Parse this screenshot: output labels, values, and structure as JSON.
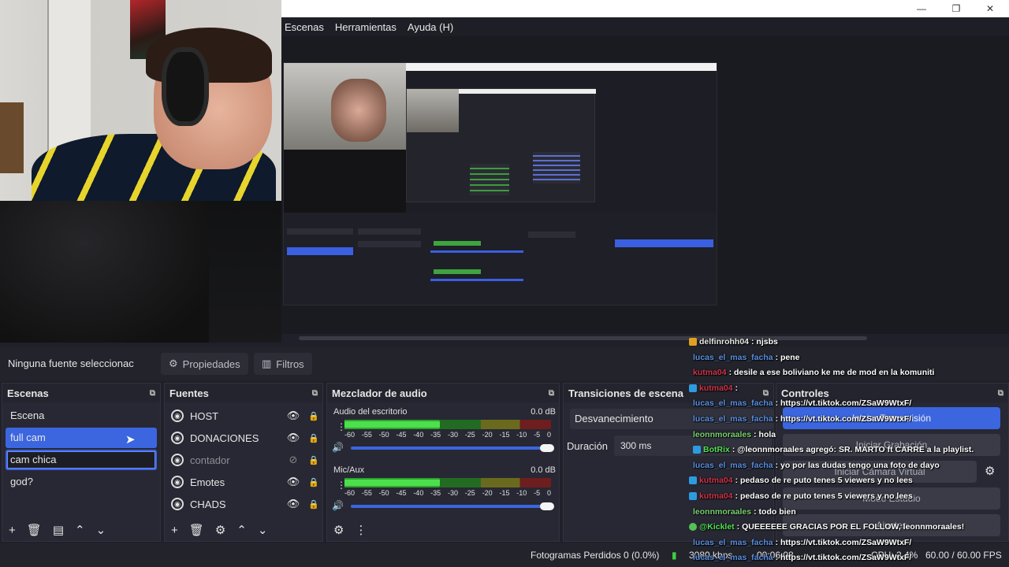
{
  "menubar": {
    "items": [
      "Escenas",
      "Herramientas",
      "Ayuda (H)"
    ]
  },
  "window": {
    "minimize": "—",
    "maximize": "❐",
    "close": "✕"
  },
  "context": {
    "no_source": "Ninguna fuente seleccionac",
    "properties": "Propiedades",
    "filters": "Filtros"
  },
  "scenes": {
    "title": "Escenas",
    "items": [
      "Escena",
      "full cam",
      "cam chica",
      "god?"
    ]
  },
  "sources": {
    "title": "Fuentes",
    "items": [
      "HOST",
      "DONACIONES",
      "contador",
      "Emotes",
      "CHADS"
    ]
  },
  "mixer": {
    "title": "Mezclador de audio",
    "channels": [
      {
        "name": "Audio del escritorio",
        "db": "0.0 dB",
        "level": 0.46
      },
      {
        "name": "Mic/Aux",
        "db": "0.0 dB",
        "level": 0.46
      }
    ],
    "ticks": [
      "-60",
      "-55",
      "-50",
      "-45",
      "-40",
      "-35",
      "-30",
      "-25",
      "-20",
      "-15",
      "-10",
      "-5",
      "0"
    ]
  },
  "transitions": {
    "title": "Transiciones de escena",
    "selected": "Desvanecimiento",
    "duration_label": "Duración",
    "duration_value": "300 ms"
  },
  "controls": {
    "title": "Controles",
    "buttons": [
      "Iniciar Transmisión",
      "Iniciar Grabación",
      "Iniciar Cámara Virtual",
      "Modo Estudio",
      "Ajustes"
    ]
  },
  "status": {
    "dropped": "Fotogramas Perdidos 0 (0.0%)",
    "kbps": "3080 kbps",
    "time": "00:06:08",
    "cpu": "CPU: 2.4%",
    "fps": "60.00 / 60.00 FPS"
  },
  "chat": [
    {
      "user": "delfinrohh04",
      "msg": ": njsbs",
      "color": "#e8e8e8",
      "icon": "#e0a020"
    },
    {
      "user": "lucas_el_mas_facha",
      "msg": ": pene",
      "color": "#5b8fe0",
      "icon": ""
    },
    {
      "user": "kutma04",
      "msg": ": desile a ese boliviano ke me de mod en la komuniti",
      "color": "#d0344a",
      "icon": ""
    },
    {
      "user": "kutma04",
      "msg": ":",
      "color": "#d0344a",
      "icon": "#2d9be0"
    },
    {
      "user": "lucas_el_mas_facha",
      "msg": ": https://vt.tiktok.com/ZSaW9WtxF/",
      "color": "#5b8fe0",
      "icon": ""
    },
    {
      "user": "lucas_el_mas_facha",
      "msg": ": https://vt.tiktok.com/ZSaW9WtxF/",
      "color": "#5b8fe0",
      "icon": ""
    },
    {
      "user": "leonnmoraales",
      "msg": ": hola",
      "color": "#7ad06f",
      "icon": ""
    },
    {
      "user": "BotRix",
      "msg": ": @leonnmoraales agregó: SR. MARTO ft CARRE a la playlist.",
      "color": "#55e055",
      "icon": "#2d9be0"
    },
    {
      "user": "lucas_el_mas_facha",
      "msg": ": yo por las dudas tengo una foto de dayo",
      "color": "#5b8fe0",
      "icon": ""
    },
    {
      "user": "kutma04",
      "msg": ": pedaso de re puto tenes 5 viewers y no lees",
      "color": "#d0344a",
      "icon": "#2d9be0"
    },
    {
      "user": "kutma04",
      "msg": ": pedaso de re puto tenes 5 viewers y no lees",
      "color": "#d0344a",
      "icon": "#2d9be0"
    },
    {
      "user": "leonnmoraales",
      "msg": ": todo bien",
      "color": "#7ad06f",
      "icon": ""
    },
    {
      "user": "@Kicklet",
      "msg": ": QUEEEEEE GRACIAS POR EL FOLLOW, leonnmoraales!",
      "color": "#55e055",
      "icon": "#55c055"
    },
    {
      "user": "lucas_el_mas_facha",
      "msg": ": https://vt.tiktok.com/ZSaW9WtxF/",
      "color": "#5b8fe0",
      "icon": ""
    },
    {
      "user": "lucas_el_mas_facha",
      "msg": ": https://vt.tiktok.com/ZSaW9WtxF/",
      "color": "#5b8fe0",
      "icon": ""
    }
  ]
}
